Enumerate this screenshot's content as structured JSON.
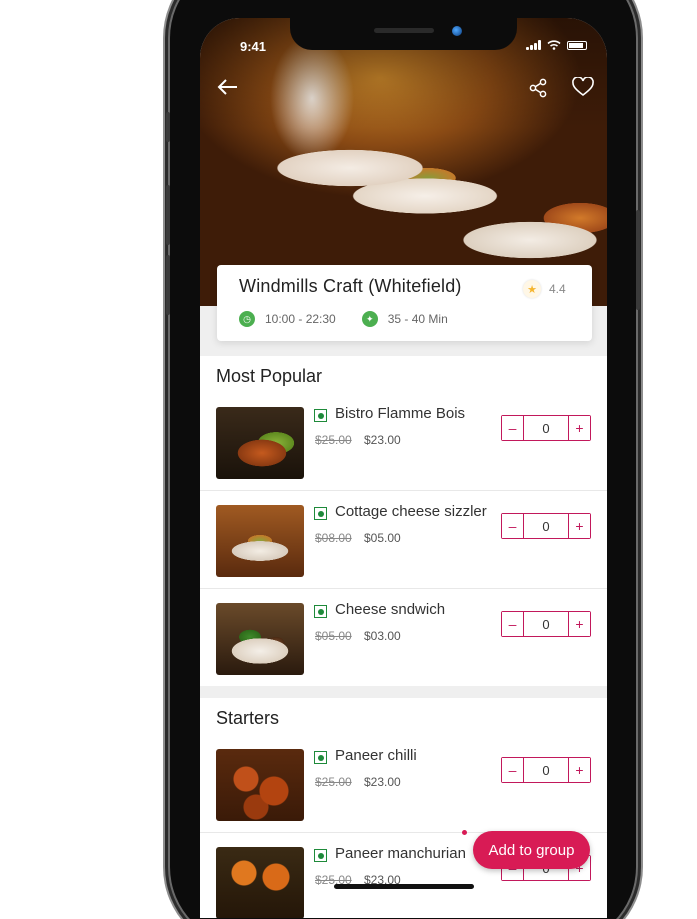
{
  "status": {
    "time": "9:41"
  },
  "hero": {
    "back_icon": "back-arrow-icon",
    "share_icon": "share-icon",
    "favorite_icon": "heart-icon"
  },
  "restaurant": {
    "name": "Windmills Craft (Whitefield)",
    "rating": "4.4",
    "hours": "10:00 - 22:30",
    "delivery_time": "35 - 40 Min"
  },
  "sections": [
    {
      "title": "Most Popular",
      "items": [
        {
          "name": "Bistro Flamme Bois",
          "old_price": "$25.00",
          "price": "$23.00",
          "qty": "0"
        },
        {
          "name": "Cottage cheese sizzler",
          "old_price": "$08.00",
          "price": "$05.00",
          "qty": "0"
        },
        {
          "name": "Cheese sndwich",
          "old_price": "$05.00",
          "price": "$03.00",
          "qty": "0"
        }
      ]
    },
    {
      "title": "Starters",
      "items": [
        {
          "name": "Paneer chilli",
          "old_price": "$25.00",
          "price": "$23.00",
          "qty": "0"
        },
        {
          "name": "Paneer manchurian",
          "old_price": "$25.00",
          "price": "$23.00",
          "qty": "0"
        }
      ]
    }
  ],
  "stepper": {
    "minus": "–",
    "plus": "+"
  },
  "actions": {
    "add_to_group": "Add to group"
  },
  "colors": {
    "accent": "#d81b55",
    "veg": "#1e8a3a",
    "meta_icon": "#4caf50",
    "star": "#f5b52e"
  }
}
